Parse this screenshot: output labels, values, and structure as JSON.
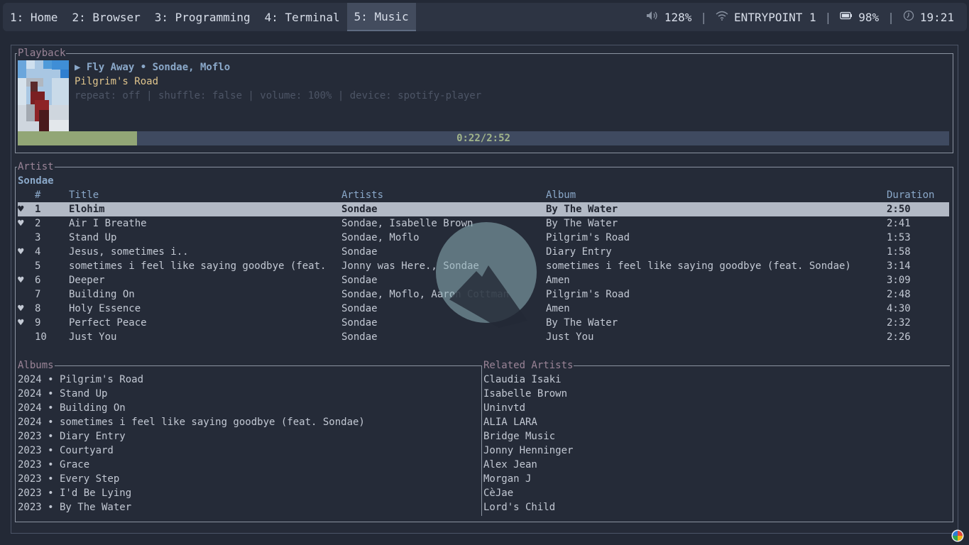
{
  "topbar": {
    "workspaces": [
      {
        "label": "1: Home"
      },
      {
        "label": "2: Browser"
      },
      {
        "label": "3: Programming"
      },
      {
        "label": "4: Terminal"
      },
      {
        "label": "5: Music"
      }
    ],
    "active_workspace": "5: Music",
    "volume": "128%",
    "network": "ENTRYPOINT 1",
    "battery": "98%",
    "clock": "19:21",
    "icons": [
      "speaker-icon",
      "wifi-icon",
      "battery-icon",
      "clock-icon"
    ]
  },
  "playback": {
    "title": "Playback",
    "now_playing": "▶ Fly Away • Sondae, Moflo",
    "album": "Pilgrim's Road",
    "info": "repeat: off | shuffle: false | volume: 100% | device: spotify-player",
    "progress_text": "0:22/2:52",
    "progress_fraction": 0.128
  },
  "artist": {
    "title": "Artist",
    "name": "Sondae",
    "columns": {
      "num": "#",
      "title": "Title",
      "artists": "Artists",
      "album": "Album",
      "duration": "Duration"
    },
    "tracks": [
      {
        "heart": "♥",
        "num": "1",
        "title": "Elohim",
        "artists": "Sondae",
        "album": "By The Water",
        "duration": "2:50"
      },
      {
        "heart": "♥",
        "num": "2",
        "title": "Air I Breathe",
        "artists": "Sondae, Isabelle Brown",
        "album": "By The Water",
        "duration": "2:41"
      },
      {
        "heart": "",
        "num": "3",
        "title": "Stand Up",
        "artists": "Sondae, Moflo",
        "album": "Pilgrim's Road",
        "duration": "1:53"
      },
      {
        "heart": "♥",
        "num": "4",
        "title": "Jesus, sometimes i..",
        "artists": "Sondae",
        "album": "Diary Entry",
        "duration": "1:58"
      },
      {
        "heart": "",
        "num": "5",
        "title": "sometimes i feel like saying goodbye (feat. So",
        "artists": "Jonny was Here., Sondae",
        "album": "sometimes i feel like saying goodbye (feat. Sondae)",
        "duration": "3:14"
      },
      {
        "heart": "♥",
        "num": "6",
        "title": "Deeper",
        "artists": "Sondae",
        "album": "Amen",
        "duration": "3:09"
      },
      {
        "heart": "",
        "num": "7",
        "title": "Building On",
        "artists": "Sondae, Moflo, Aaron Cottman",
        "album": "Pilgrim's Road",
        "duration": "2:48"
      },
      {
        "heart": "♥",
        "num": "8",
        "title": "Holy Essence",
        "artists": "Sondae",
        "album": "Amen",
        "duration": "4:30"
      },
      {
        "heart": "♥",
        "num": "9",
        "title": "Perfect Peace",
        "artists": "Sondae",
        "album": "By The Water",
        "duration": "2:32"
      },
      {
        "heart": "",
        "num": "10",
        "title": "Just You",
        "artists": "Sondae",
        "album": "Just You",
        "duration": "2:26"
      }
    ],
    "albums_title": "Albums",
    "albums": [
      "2024 • Pilgrim's Road",
      "2024 • Stand Up",
      "2024 • Building On",
      "2024 • sometimes i feel like saying goodbye (feat. Sondae)",
      "2023 • Diary Entry",
      "2023 • Courtyard",
      "2023 • Grace",
      "2023 • Every Step",
      "2023 • I'd Be Lying",
      "2023 • By The Water"
    ],
    "related_title": "Related Artists",
    "related": [
      "Claudia Isaki",
      "Isabelle Brown",
      "Uninvtd",
      "ALIA LARA",
      "Bridge Music",
      "Jonny Henninger",
      "Alex Jean",
      "Morgan J",
      "CèJae",
      "Lord's Child"
    ]
  }
}
